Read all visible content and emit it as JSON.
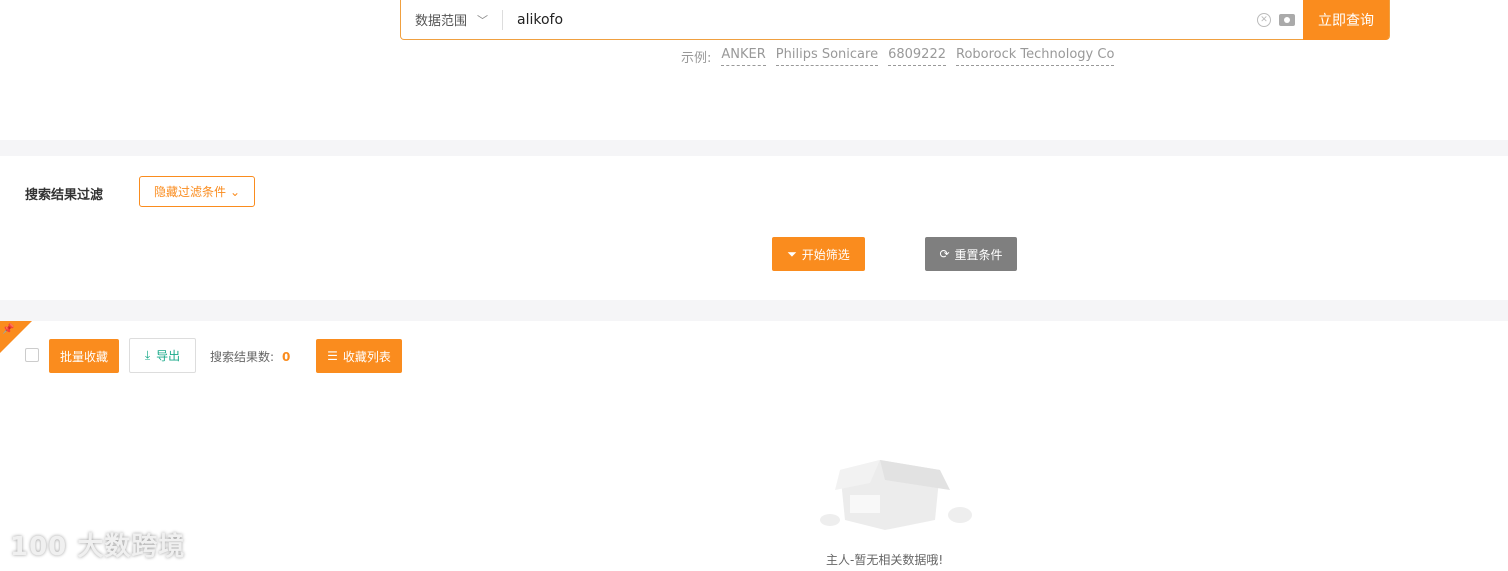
{
  "search": {
    "scope_label": "数据范围",
    "query": "alikofo",
    "submit_label": "立即查询",
    "examples_label": "示例:",
    "examples": [
      "ANKER",
      "Philips Sonicare",
      "6809222",
      "Roborock Technology Co"
    ]
  },
  "filter": {
    "label": "搜索结果过滤",
    "toggle_label": "隐藏过滤条件",
    "apply_label": "开始筛选",
    "reset_label": "重置条件"
  },
  "results": {
    "bulk_favorite_label": "批量收藏",
    "export_label": "导出",
    "count_label": "搜索结果数:",
    "count": "0",
    "favorites_list_label": "收藏列表",
    "empty_text": "主人-暂无相关数据哦!"
  },
  "watermark": "100 大数跨境",
  "colors": {
    "accent": "#fa8c1e",
    "grey": "#7f7f7f",
    "export": "#1aaa8a"
  }
}
